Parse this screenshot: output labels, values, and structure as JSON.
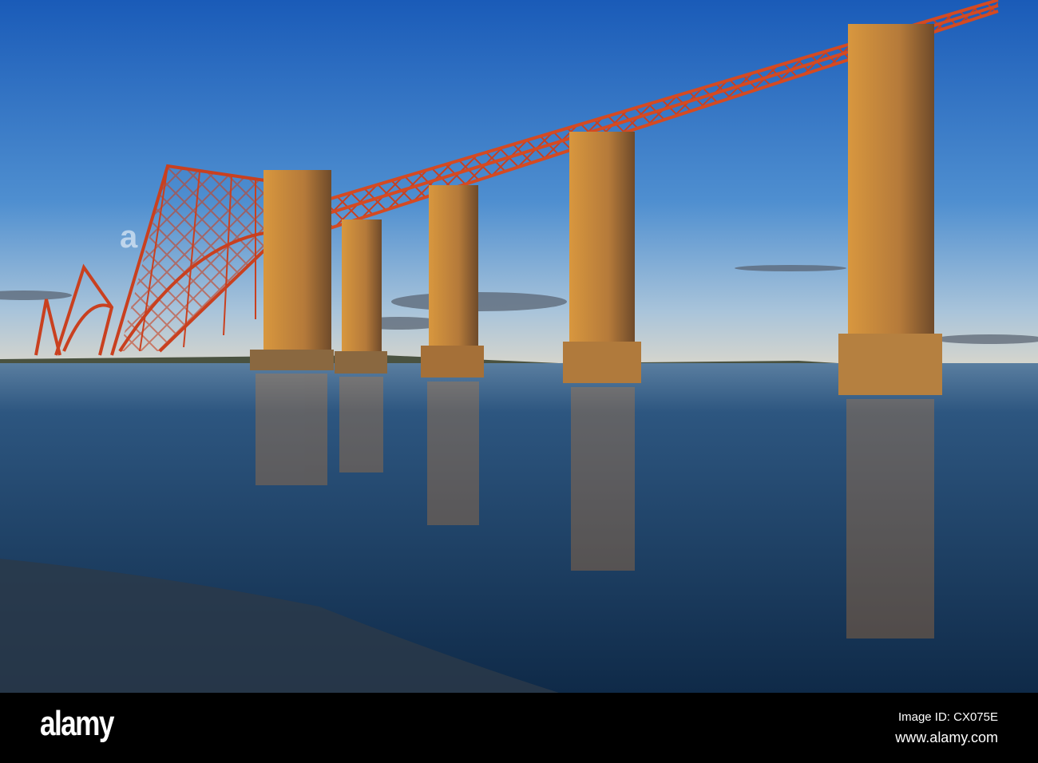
{
  "photo": {
    "subject": "Forth Bridge at sunset"
  },
  "watermark": {
    "logo_text": "alamy",
    "image_id": "Image ID: CX075E",
    "website": "www.alamy.com"
  },
  "colors": {
    "sky_top": "#1f5fb8",
    "sky_horizon": "#c9d7e0",
    "water": "#1d3f66",
    "steel": "#c9401f",
    "stone": "#b57a3a"
  }
}
